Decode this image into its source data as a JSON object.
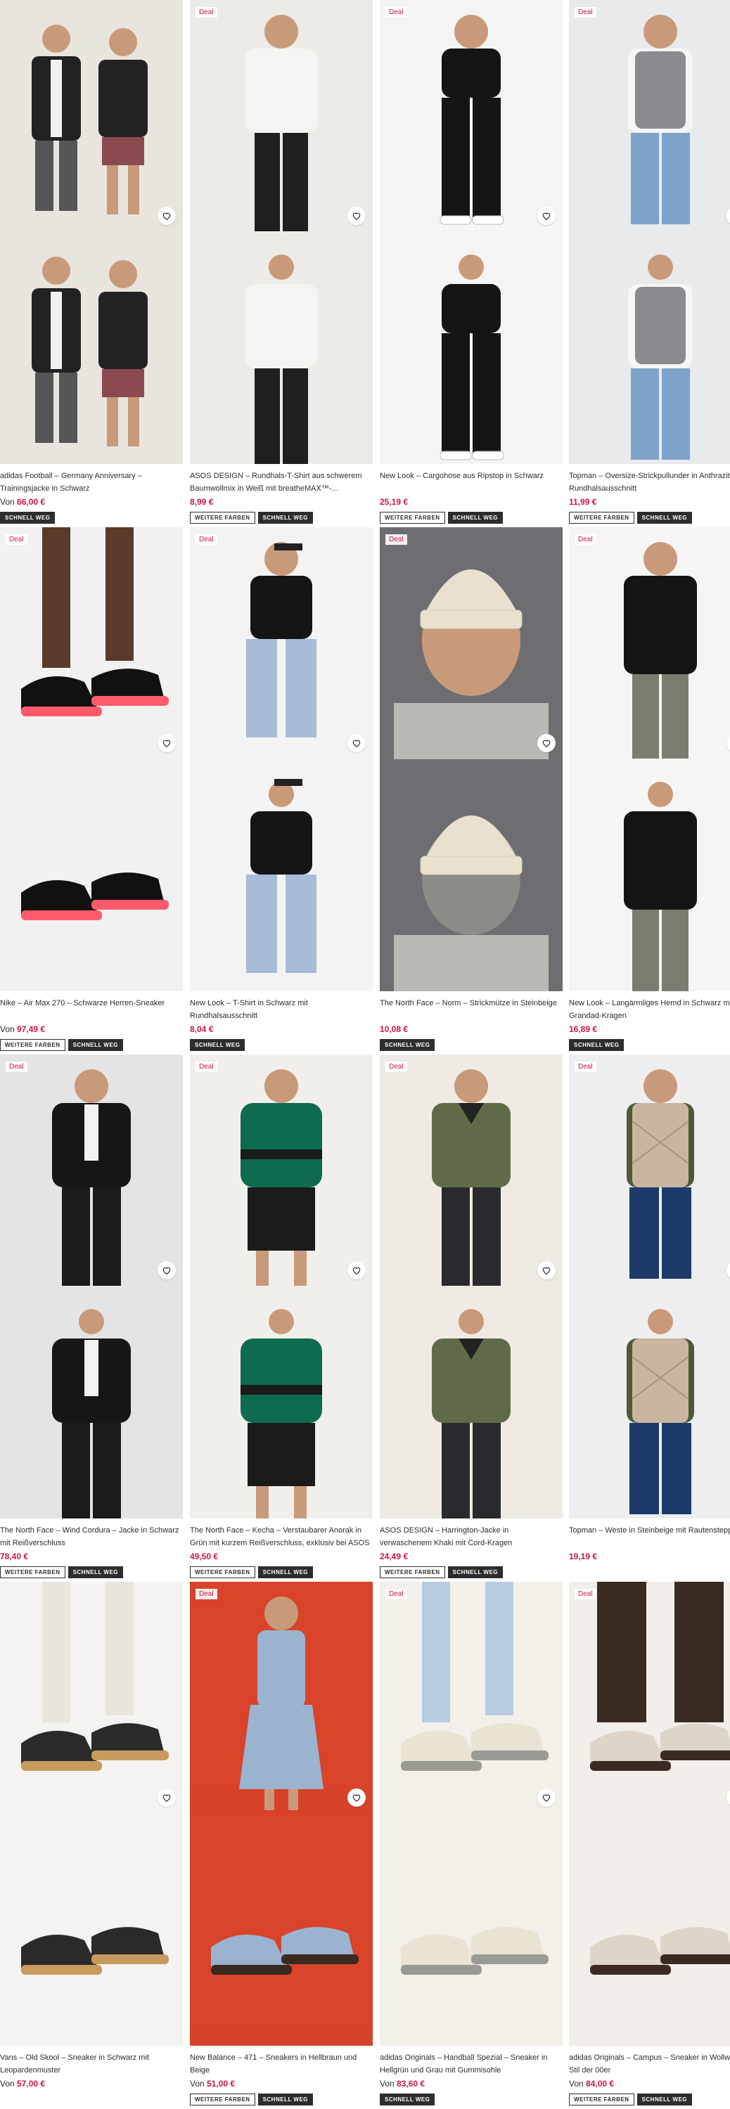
{
  "labels": {
    "deal": "Deal",
    "more_colors": "WEITERE FARBEN",
    "selling_fast": "SCHNELL WEG"
  },
  "products": [
    {
      "name": "adidas Football – Germany Anniversary – Trainingsjacke in Schwarz",
      "price_prefix": "Von ",
      "price": "66,00 €",
      "deal": false,
      "more_colors": false,
      "selling_fast": true,
      "colors": {
        "bg": "#e8e4de",
        "fg": "#222222",
        "accent": "#f2f2f2"
      },
      "scene": "duo"
    },
    {
      "name": "ASOS DESIGN – Rundhals-T-Shirt aus schwerem Baumwollmix in Weiß mit breatheMAX™-...",
      "price_prefix": "",
      "price": "8,99 €",
      "deal": true,
      "more_colors": true,
      "selling_fast": true,
      "colors": {
        "bg": "#ecebe8",
        "fg": "#f4f4f2",
        "accent": "#1f1f22"
      },
      "scene": "tshirt"
    },
    {
      "name": "New Look – Cargohose aus Ripstop in Schwarz",
      "price_prefix": "",
      "price": "25,19 €",
      "deal": true,
      "more_colors": true,
      "selling_fast": true,
      "colors": {
        "bg": "#f4f4f4",
        "fg": "#151515",
        "accent": "#ffffff"
      },
      "scene": "cargo"
    },
    {
      "name": "Topman – Oversize-Strickpullunder in Anthrazit mit Rundhalsausschnitt",
      "price_prefix": "",
      "price": "11,99 €",
      "deal": true,
      "more_colors": true,
      "selling_fast": true,
      "colors": {
        "bg": "#e9eaec",
        "fg": "#8a8b8e",
        "accent": "#7ea2c9"
      },
      "scene": "vest"
    },
    {
      "name": "Nike – Air Max 270 – Schwarze Herren-Sneaker",
      "price_prefix": "Von ",
      "price": "97,49 €",
      "deal": true,
      "more_colors": true,
      "selling_fast": true,
      "colors": {
        "bg": "#f1f1f1",
        "fg": "#111111",
        "accent": "#ff5a6a"
      },
      "scene": "sneaker"
    },
    {
      "name": "New Look – T-Shirt in Schwarz mit Rundhalsausschnitt",
      "price_prefix": "",
      "price": "8,04 €",
      "deal": true,
      "more_colors": false,
      "selling_fast": true,
      "colors": {
        "bg": "#f3f3f3",
        "fg": "#151515",
        "accent": "#a8bcd6"
      },
      "scene": "blacktee"
    },
    {
      "name": "The North Face – Norm – Strickmütze in Steinbeige",
      "price_prefix": "",
      "price": "10,08 €",
      "deal": true,
      "more_colors": false,
      "selling_fast": true,
      "colors": {
        "bg": "#6e6e72",
        "fg": "#e9e1d0",
        "accent": "#b9b9b5"
      },
      "scene": "beanie"
    },
    {
      "name": "New Look – Langärmliges Hemd in Schwarz mit Grandad-Kragen",
      "price_prefix": "",
      "price": "16,89 €",
      "deal": true,
      "more_colors": false,
      "selling_fast": true,
      "colors": {
        "bg": "#f5f5f5",
        "fg": "#141414",
        "accent": "#7d7c70"
      },
      "scene": "shirt"
    },
    {
      "name": "The North Face – Wind Cordura – Jacke in Schwarz mit Reißverschluss",
      "price_prefix": "",
      "price": "78,40 €",
      "deal": true,
      "more_colors": true,
      "selling_fast": true,
      "colors": {
        "bg": "#e4e4e6",
        "fg": "#161616",
        "accent": "#f2f2f2"
      },
      "scene": "jacket"
    },
    {
      "name": "The North Face – Kecha – Verstaubarer Anorak in Grün mit kurzem Reißverschluss, exklusiv bei ASOS",
      "price_prefix": "",
      "price": "49,50 €",
      "deal": true,
      "more_colors": true,
      "selling_fast": true,
      "colors": {
        "bg": "#f1efec",
        "fg": "#0f6b4f",
        "accent": "#1b1b1b"
      },
      "scene": "anorak"
    },
    {
      "name": "ASOS DESIGN – Harrington-Jacke in verwaschenem Khaki mit Cord-Kragen",
      "price_prefix": "",
      "price": "24,49 €",
      "deal": true,
      "more_colors": true,
      "selling_fast": true,
      "colors": {
        "bg": "#efebe4",
        "fg": "#5f6b48",
        "accent": "#2a2a2e"
      },
      "scene": "harrington"
    },
    {
      "name": "Topman – Weste in Steinbeige mit Rautensteppung",
      "price_prefix": "",
      "price": "19,19 €",
      "deal": true,
      "more_colors": false,
      "selling_fast": false,
      "colors": {
        "bg": "#eeeef0",
        "fg": "#c9b6a0",
        "accent": "#1e3a6b"
      },
      "scene": "quiltvest"
    },
    {
      "name": "Vans – Old Skool – Sneaker in Schwarz mit Leopardenmuster",
      "price_prefix": "Von ",
      "price": "57,00 €",
      "deal": false,
      "more_colors": false,
      "selling_fast": false,
      "colors": {
        "bg": "#f4f3f1",
        "fg": "#2a2a2a",
        "accent": "#c79b5d"
      },
      "scene": "vans"
    },
    {
      "name": "New Balance – 471 – Sneakers in Hellbraun und Beige",
      "price_prefix": "Von ",
      "price": "51,00 €",
      "deal": true,
      "more_colors": true,
      "selling_fast": true,
      "colors": {
        "bg": "#d8432a",
        "fg": "#9ab4cf",
        "accent": "#3a2a22"
      },
      "scene": "nb"
    },
    {
      "name": "adidas Originals – Handball Spezial – Sneaker in Hellgrün und Grau mit Gummisohle",
      "price_prefix": "Von ",
      "price": "83,60 €",
      "deal": true,
      "more_colors": false,
      "selling_fast": true,
      "colors": {
        "bg": "#f3efe9",
        "fg": "#e8e3d2",
        "accent": "#9a9a94"
      },
      "scene": "spezial"
    },
    {
      "name": "adidas Originals – Campus – Sneaker in Wollweiß im Stil der 00er",
      "price_prefix": "Von ",
      "price": "84,00 €",
      "deal": true,
      "more_colors": true,
      "selling_fast": true,
      "colors": {
        "bg": "#f2efea",
        "fg": "#ddd6c8",
        "accent": "#3a2a24"
      },
      "scene": "campus"
    }
  ]
}
